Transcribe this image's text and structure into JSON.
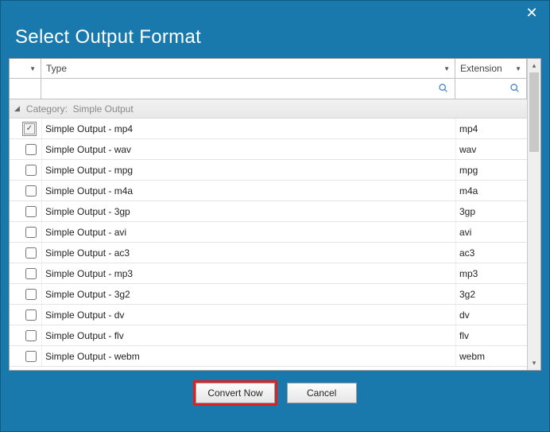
{
  "window": {
    "title": "Select Output Format"
  },
  "columns": {
    "type": "Type",
    "extension": "Extension"
  },
  "group": {
    "label_prefix": "Category:",
    "label_value": "Simple Output"
  },
  "rows": [
    {
      "type": "Simple Output - mp4",
      "ext": "mp4",
      "checked": true
    },
    {
      "type": "Simple Output - wav",
      "ext": "wav",
      "checked": false
    },
    {
      "type": "Simple Output - mpg",
      "ext": "mpg",
      "checked": false
    },
    {
      "type": "Simple Output - m4a",
      "ext": "m4a",
      "checked": false
    },
    {
      "type": "Simple Output - 3gp",
      "ext": "3gp",
      "checked": false
    },
    {
      "type": "Simple Output - avi",
      "ext": "avi",
      "checked": false
    },
    {
      "type": "Simple Output - ac3",
      "ext": "ac3",
      "checked": false
    },
    {
      "type": "Simple Output - mp3",
      "ext": "mp3",
      "checked": false
    },
    {
      "type": "Simple Output - 3g2",
      "ext": "3g2",
      "checked": false
    },
    {
      "type": "Simple Output - dv",
      "ext": "dv",
      "checked": false
    },
    {
      "type": "Simple Output - flv",
      "ext": "flv",
      "checked": false
    },
    {
      "type": "Simple Output - webm",
      "ext": "webm",
      "checked": false
    }
  ],
  "footer": {
    "primary": "Convert Now",
    "cancel": "Cancel"
  }
}
